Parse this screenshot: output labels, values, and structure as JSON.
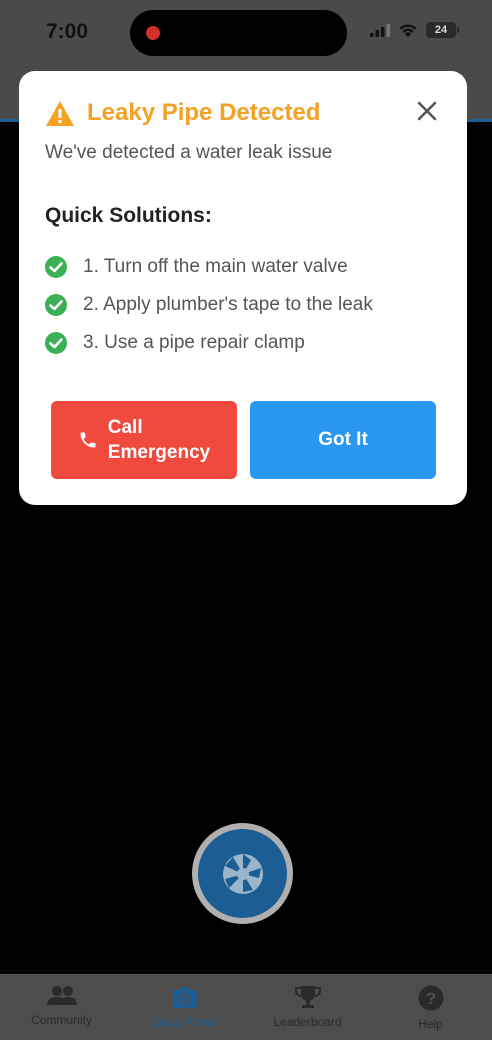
{
  "status_bar": {
    "time": "7:00",
    "battery": "24"
  },
  "modal": {
    "title": "Leaky Pipe Detected",
    "subtitle": "We've detected a water leak issue",
    "solutions_heading": "Quick Solutions:",
    "solutions": [
      "1. Turn off the main water valve",
      "2. Apply plumber's tape to the leak",
      "3. Use a pipe repair clamp"
    ],
    "call_line1": "Call",
    "call_line2": "Emergency",
    "got_it_label": "Got It"
  },
  "tabbar": {
    "tabs": [
      {
        "label": "Community",
        "icon": "people-icon"
      },
      {
        "label": "Snap Photo",
        "icon": "camera-icon",
        "active": true
      },
      {
        "label": "Leaderboard",
        "icon": "trophy-icon"
      },
      {
        "label": "Help",
        "icon": "help-icon"
      }
    ]
  },
  "colors": {
    "title": "#f4a124",
    "call_button": "#f04a3e",
    "got_it_button": "#2a98f0",
    "check": "#3cb054",
    "active_tab": "#1c5d93"
  }
}
